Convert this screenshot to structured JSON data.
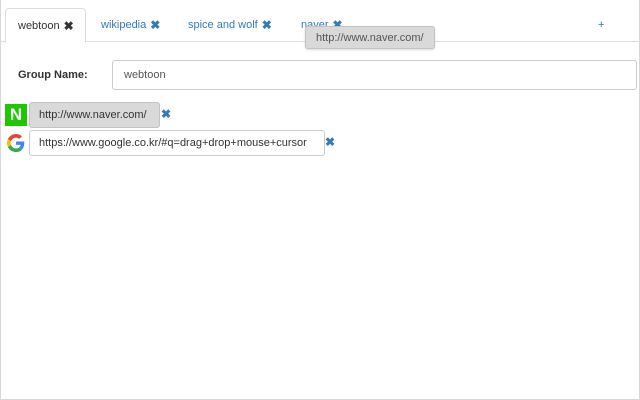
{
  "tabs": [
    {
      "label": "webtoon",
      "close": "✖",
      "active": true
    },
    {
      "label": "wikipedia",
      "close": "✖",
      "active": false
    },
    {
      "label": "spice and wolf",
      "close": "✖",
      "active": false
    },
    {
      "label": "naver",
      "close": "✖",
      "active": false
    }
  ],
  "add_tab_label": "+",
  "drag_tooltip": "http://www.naver.com/",
  "group": {
    "label": "Group Name:",
    "value": "webtoon"
  },
  "urls": [
    {
      "value": "http://www.naver.com/",
      "icon": "naver-icon",
      "icon_text": "N",
      "remove": "✖"
    },
    {
      "value": "https://www.google.co.kr/#q=drag+drop+mouse+cursor",
      "icon": "google-icon",
      "remove": "✖"
    }
  ],
  "colors": {
    "link": "#337ab7",
    "naver_green": "#1ec800",
    "dragging_bg": "#d9d9d9"
  }
}
